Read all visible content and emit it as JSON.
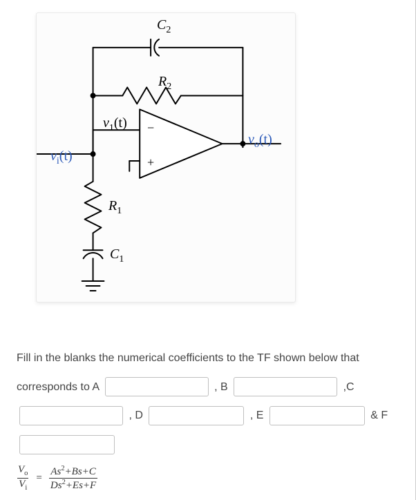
{
  "circuit": {
    "labels": {
      "C2": "C",
      "C2_sub": "2",
      "R2": "R",
      "R2_sub": "2",
      "v1t": "v",
      "v1t_sub": "1",
      "v1t_arg": "(t)",
      "vit": "v",
      "vit_sub": "i",
      "vit_arg": "(t)",
      "vot": "v",
      "vot_sub": "o",
      "vot_arg": "(t)",
      "R1": "R",
      "R1_sub": "1",
      "C1": "C",
      "C1_sub": "1",
      "minus": "−",
      "plus": "+"
    }
  },
  "prompt": {
    "line1_a": "Fill in the blanks the numerical coefficients to the TF shown below that",
    "line2_a": "corresponds to A",
    "sep_b": ", B",
    "sep_c": ",C",
    "sep_d": ", D",
    "sep_e": ", E",
    "sep_f": "& F"
  },
  "inputs": {
    "A": "",
    "B": "",
    "C": "",
    "D": "",
    "E": "",
    "F": ""
  },
  "equation": {
    "lhs_num": "V",
    "lhs_num_sub": "o",
    "lhs_den": "V",
    "lhs_den_sub": "i",
    "eq": "=",
    "rhs_num": "As²+Bs+C",
    "rhs_den": "Ds²+Es+F"
  }
}
